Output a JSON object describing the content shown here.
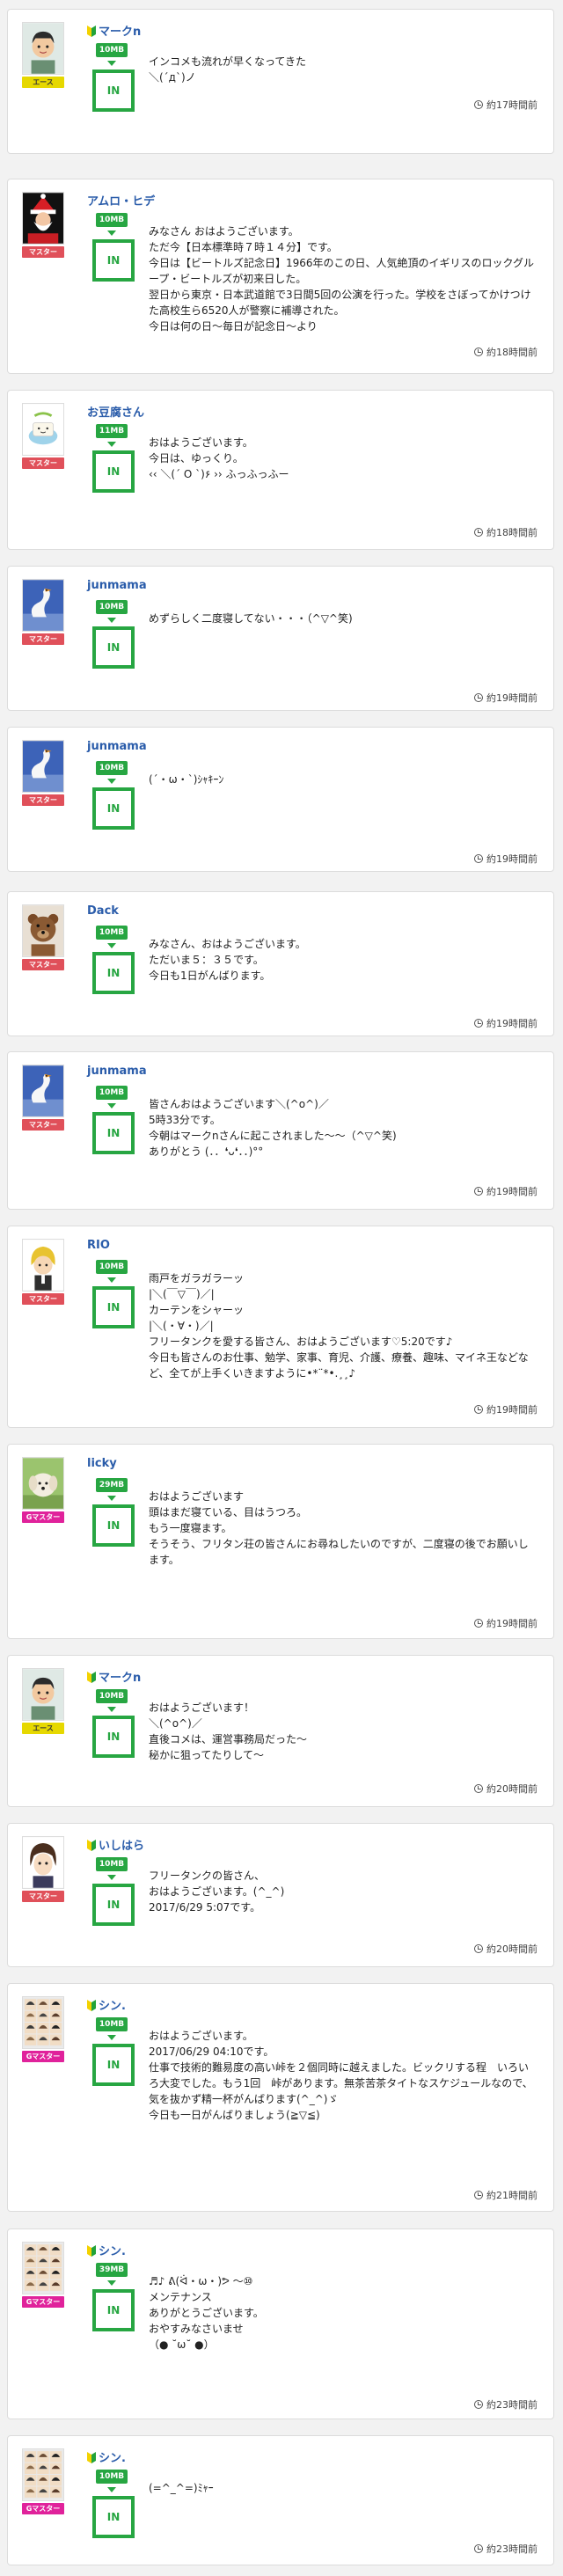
{
  "colors": {
    "accent_green": "#27a642",
    "username_blue": "#2a5caa",
    "badge_ace": "#e6d800",
    "badge_master": "#e0505a",
    "badge_gmaster": "#e0229b"
  },
  "posts": [
    {
      "username": "マークn",
      "leaf": true,
      "avatar": "boy",
      "badge": "エース",
      "badge_type": "ace",
      "mb": "10MB",
      "in_label": "IN",
      "message": "インコメも流れが早くなってきた\n＼(´д`)ノ",
      "time": "約17時間前"
    },
    {
      "username": "アムロ・ヒデ",
      "leaf": false,
      "avatar": "santa",
      "badge": "マスター",
      "badge_type": "master",
      "mb": "10MB",
      "in_label": "IN",
      "message": "みなさん おはようございます。\nただ今【日本標準時７時１４分】です。\n今日は【ビートルズ記念日】1966年のこの日、人気絶頂のイギリスのロックグループ・ビートルズが初来日した。\n翌日から東京・日本武道館で3日間5回の公演を行った。学校をさぼってかけつけた高校生ら6520人が警察に補導された。\n今日は何の日～毎日が記念日～より",
      "time": "約18時間前"
    },
    {
      "username": "お豆腐さん",
      "leaf": false,
      "avatar": "tofu",
      "badge": "マスター",
      "badge_type": "master",
      "mb": "11MB",
      "in_label": "IN",
      "message": "おはようございます。\n今日は、ゆっくり。\n‹‹ ＼(´ O `)۶ ›› ふっふっふー",
      "time": "約18時間前"
    },
    {
      "username": "junmama",
      "leaf": false,
      "avatar": "swan",
      "badge": "マスター",
      "badge_type": "master",
      "mb": "10MB",
      "in_label": "IN",
      "message": "めずらしく二度寝してない・・・（^▽^笑)",
      "time": "約19時間前"
    },
    {
      "username": "junmama",
      "leaf": false,
      "avatar": "swan",
      "badge": "マスター",
      "badge_type": "master",
      "mb": "10MB",
      "in_label": "IN",
      "message": "(´・ω・`)ｼｬｷｰﾝ",
      "time": "約19時間前"
    },
    {
      "username": "Dack",
      "leaf": false,
      "avatar": "bear",
      "badge": "マスター",
      "badge_type": "master",
      "mb": "10MB",
      "in_label": "IN",
      "message": "みなさん、おはようございます。\nただいま５：３５です。\n今日も1日がんばります。",
      "time": "約19時間前"
    },
    {
      "username": "junmama",
      "leaf": false,
      "avatar": "swan",
      "badge": "マスター",
      "badge_type": "master",
      "mb": "10MB",
      "in_label": "IN",
      "message": "皆さんおはようございます＼(^o^)／\n5時33分です。\n今朝はマークnさんに起こされました～～（^▽^笑)\nありがとう (．．❛ᴗ❛．．)°°",
      "time": "約19時間前"
    },
    {
      "username": "RIO",
      "leaf": false,
      "avatar": "rio",
      "badge": "マスター",
      "badge_type": "master",
      "mb": "10MB",
      "in_label": "IN",
      "message": "雨戸をガラガラーッ\n|＼(￣▽￣)／|\nカーテンをシャーッ\n|＼(・∀・)／|\nフリータンクを愛する皆さん、おはようございます♡5:20です♪\n今日も皆さんのお仕事、勉学、家事、育児、介護、療養、趣味、マイネ王などなど、全てが上手くいきますように•*¨*•.¸¸♪",
      "time": "約19時間前"
    },
    {
      "username": "licky",
      "leaf": false,
      "avatar": "dog",
      "badge": "Gマスター",
      "badge_type": "gmaster",
      "mb": "29MB",
      "in_label": "IN",
      "message": "おはようございます\n頭はまだ寝ている、目はうつろ。\nもう一度寝ます。\nそうそう、フリタン荘の皆さんにお尋ねしたいのですが、二度寝の後でお願いします。",
      "time": "約19時間前"
    },
    {
      "username": "マークn",
      "leaf": true,
      "avatar": "boy",
      "badge": "エース",
      "badge_type": "ace",
      "mb": "10MB",
      "in_label": "IN",
      "message": "おはようございます！\n＼(^o^)／\n直後コメは、運営事務局だった～\n秘かに狙ってたりして～",
      "time": "約20時間前"
    },
    {
      "username": "いしはら",
      "leaf": true,
      "avatar": "anime",
      "badge": "マスター",
      "badge_type": "master",
      "mb": "10MB",
      "in_label": "IN",
      "message": "フリータンクの皆さん、\nおはようございます。(^_^)\n2017/6/29 5:07です。",
      "time": "約20時間前"
    },
    {
      "username": "シン.",
      "leaf": true,
      "avatar": "grid",
      "badge": "Gマスター",
      "badge_type": "gmaster",
      "mb": "10MB",
      "in_label": "IN",
      "message": "おはようございます。\n2017/06/29 04:10です。\n仕事で技術的難易度の高い峠を２個同時に越えました。ビックリする程　いろいろ大変でした。もう1回　峠があります。無茶苦茶タイトなスケジュールなので、気を抜かず精一杯がんばります(^_^)ゞ\n今日も一日がんばりましょう(≧▽≦)",
      "time": "約21時間前"
    },
    {
      "username": "シン.",
      "leaf": true,
      "avatar": "grid",
      "badge": "Gマスター",
      "badge_type": "gmaster",
      "mb": "39MB",
      "in_label": "IN",
      "message": "♬♪ ᕕ(ᐛ・ω・)ᕗ 〜⑩\nメンテナンス\nありがとうございます。\nおやすみなさいませ\n（● ˘ω˘ ●）",
      "time": "約23時間前"
    },
    {
      "username": "シン.",
      "leaf": true,
      "avatar": "grid",
      "badge": "Gマスター",
      "badge_type": "gmaster",
      "mb": "10MB",
      "in_label": "IN",
      "message": "(=^_^=)ﾐｬｰ",
      "time": "約23時間前"
    }
  ]
}
